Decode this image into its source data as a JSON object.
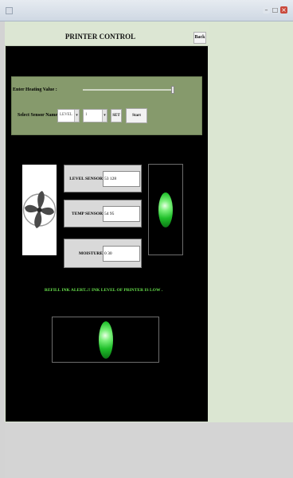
{
  "header": {
    "title": "PRINTER CONTROL",
    "back_label": "Back"
  },
  "controls": {
    "heating_label": "Enter Heating Value :",
    "sensor_label": "Select Sensor Name",
    "sensor_select_value": "LEVEL",
    "value_select_value": "1",
    "set_label": "SET",
    "start_label": "Start"
  },
  "sensors": [
    {
      "name": "LEVEL SENSOR",
      "value": "53 128"
    },
    {
      "name": "TEMP SENSOR",
      "value": "54 95"
    },
    {
      "name": "MOISTURE",
      "value": "0 30"
    }
  ],
  "alert": "REFILL INK ALERT..!! INK LEVEL OF PRINTER IS LOW .",
  "icons": [
    "fan-icon",
    "status-led-icon",
    "alert-led-icon"
  ],
  "colors": {
    "panel": "#000000",
    "control_band": "#869a6c",
    "alert_text": "#67e04c",
    "led": "#1fbf2a"
  }
}
